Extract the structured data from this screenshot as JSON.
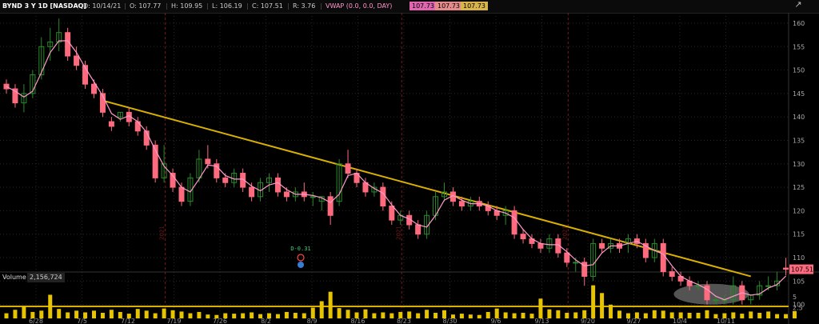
{
  "header": {
    "symbol": "BYND 3 Y 1D [NASDAQ]",
    "date": "D: 10/14/21",
    "open": "O: 107.77",
    "high": "H: 109.95",
    "low": "L: 106.19",
    "close": "C: 107.51",
    "range": "R: 3.76",
    "vwap_label": "VWAP (0.0, 0.0, DAY)",
    "vwap_val1": "107.73",
    "vwap_val2": "107.73",
    "vwap_val3": "107.73"
  },
  "volume_header": {
    "label": "Volume",
    "value": "2,156,724"
  },
  "icons": {
    "zoom": "magnify-zoom-icon"
  },
  "colors": {
    "up": "#2a8a2a",
    "down": "#ff6b7e",
    "vwap": "#ff99cc",
    "trend": "#d9b000",
    "volume": "#e6c400",
    "background": "#000000",
    "grid": "#262626"
  },
  "chart_data": {
    "type": "candlestick",
    "price_axis": {
      "ticks": [
        160,
        155,
        150,
        145,
        140,
        135,
        130,
        125,
        120,
        115,
        110,
        105,
        100
      ],
      "ylim": [
        97,
        163
      ]
    },
    "volume_axis": {
      "ticks": [
        5,
        2.5
      ]
    },
    "last_price_label": "107.51",
    "x_labels": [
      "6/28",
      "7/5",
      "7/12",
      "7/19",
      "7/26",
      "8/2",
      "8/9",
      "8/16",
      "8/23",
      "8/30",
      "9/6",
      "9/13",
      "9/20",
      "9/27",
      "10/4",
      "10/11"
    ],
    "annotation": "D-0.31",
    "candles": [
      {
        "o": 147,
        "h": 148,
        "l": 145,
        "c": 146
      },
      {
        "o": 146,
        "h": 147,
        "l": 142,
        "c": 143
      },
      {
        "o": 143,
        "h": 147,
        "l": 141,
        "c": 145
      },
      {
        "o": 145,
        "h": 150,
        "l": 144,
        "c": 149
      },
      {
        "o": 149,
        "h": 157,
        "l": 148,
        "c": 155
      },
      {
        "o": 155,
        "h": 159,
        "l": 152,
        "c": 156
      },
      {
        "o": 156,
        "h": 161,
        "l": 154,
        "c": 158
      },
      {
        "o": 158,
        "h": 159,
        "l": 152,
        "c": 153
      },
      {
        "o": 153,
        "h": 155,
        "l": 150,
        "c": 151
      },
      {
        "o": 151,
        "h": 152,
        "l": 146,
        "c": 147
      },
      {
        "o": 147,
        "h": 148,
        "l": 144,
        "c": 145
      },
      {
        "o": 145,
        "h": 146,
        "l": 140,
        "c": 141
      },
      {
        "o": 139,
        "h": 140,
        "l": 137,
        "c": 138
      },
      {
        "o": 140,
        "h": 141,
        "l": 139,
        "c": 141
      },
      {
        "o": 141,
        "h": 142,
        "l": 138,
        "c": 139
      },
      {
        "o": 139,
        "h": 140,
        "l": 136,
        "c": 137
      },
      {
        "o": 137,
        "h": 138,
        "l": 133,
        "c": 134
      },
      {
        "o": 134,
        "h": 135,
        "l": 126,
        "c": 127
      },
      {
        "o": 127,
        "h": 134,
        "l": 126,
        "c": 130
      },
      {
        "o": 128,
        "h": 129,
        "l": 124,
        "c": 125
      },
      {
        "o": 125,
        "h": 126,
        "l": 121,
        "c": 122
      },
      {
        "o": 122,
        "h": 128,
        "l": 121,
        "c": 127
      },
      {
        "o": 127,
        "h": 133,
        "l": 126,
        "c": 131
      },
      {
        "o": 131,
        "h": 134,
        "l": 129,
        "c": 130
      },
      {
        "o": 130,
        "h": 131,
        "l": 126,
        "c": 127
      },
      {
        "o": 127,
        "h": 128,
        "l": 125,
        "c": 126
      },
      {
        "o": 126,
        "h": 129,
        "l": 125,
        "c": 128
      },
      {
        "o": 128,
        "h": 129,
        "l": 124,
        "c": 125
      },
      {
        "o": 125,
        "h": 126,
        "l": 122,
        "c": 123
      },
      {
        "o": 123,
        "h": 127,
        "l": 122,
        "c": 126
      },
      {
        "o": 126,
        "h": 128,
        "l": 124,
        "c": 127
      },
      {
        "o": 127,
        "h": 128,
        "l": 123,
        "c": 124
      },
      {
        "o": 124,
        "h": 125,
        "l": 122,
        "c": 123
      },
      {
        "o": 123,
        "h": 125,
        "l": 122,
        "c": 124
      },
      {
        "o": 124,
        "h": 126,
        "l": 122,
        "c": 123
      },
      {
        "o": 123,
        "h": 124,
        "l": 121,
        "c": 123
      },
      {
        "o": 122,
        "h": 123,
        "l": 120,
        "c": 123
      },
      {
        "o": 123,
        "h": 124,
        "l": 117,
        "c": 119
      },
      {
        "o": 122,
        "h": 131,
        "l": 121,
        "c": 130
      },
      {
        "o": 130,
        "h": 133,
        "l": 127,
        "c": 128
      },
      {
        "o": 128,
        "h": 129,
        "l": 125,
        "c": 126
      },
      {
        "o": 126,
        "h": 127,
        "l": 123,
        "c": 124
      },
      {
        "o": 124,
        "h": 126,
        "l": 123,
        "c": 125
      },
      {
        "o": 125,
        "h": 126,
        "l": 120,
        "c": 121
      },
      {
        "o": 121,
        "h": 122,
        "l": 117,
        "c": 118
      },
      {
        "o": 118,
        "h": 120,
        "l": 117,
        "c": 119
      },
      {
        "o": 119,
        "h": 120,
        "l": 116,
        "c": 117
      },
      {
        "o": 117,
        "h": 118,
        "l": 114,
        "c": 115
      },
      {
        "o": 115,
        "h": 120,
        "l": 114,
        "c": 119
      },
      {
        "o": 119,
        "h": 124,
        "l": 118,
        "c": 123
      },
      {
        "o": 123,
        "h": 126,
        "l": 122,
        "c": 124
      },
      {
        "o": 124,
        "h": 125,
        "l": 121,
        "c": 122
      },
      {
        "o": 122,
        "h": 123,
        "l": 120,
        "c": 121
      },
      {
        "o": 121,
        "h": 123,
        "l": 120,
        "c": 122
      },
      {
        "o": 122,
        "h": 123,
        "l": 120,
        "c": 121
      },
      {
        "o": 121,
        "h": 122,
        "l": 119,
        "c": 120
      },
      {
        "o": 120,
        "h": 121,
        "l": 118,
        "c": 119
      },
      {
        "o": 119,
        "h": 121,
        "l": 117,
        "c": 120
      },
      {
        "o": 120,
        "h": 121,
        "l": 114,
        "c": 115
      },
      {
        "o": 115,
        "h": 116,
        "l": 113,
        "c": 114
      },
      {
        "o": 114,
        "h": 115,
        "l": 112,
        "c": 113
      },
      {
        "o": 113,
        "h": 114,
        "l": 111,
        "c": 112
      },
      {
        "o": 112,
        "h": 115,
        "l": 111,
        "c": 114
      },
      {
        "o": 114,
        "h": 115,
        "l": 110,
        "c": 111
      },
      {
        "o": 111,
        "h": 112,
        "l": 108,
        "c": 109
      },
      {
        "o": 109,
        "h": 110,
        "l": 107,
        "c": 109
      },
      {
        "o": 109,
        "h": 110,
        "l": 104,
        "c": 106
      },
      {
        "o": 106,
        "h": 114,
        "l": 105,
        "c": 113
      },
      {
        "o": 113,
        "h": 114,
        "l": 111,
        "c": 112
      },
      {
        "o": 112,
        "h": 114,
        "l": 111,
        "c": 113
      },
      {
        "o": 113,
        "h": 114,
        "l": 111,
        "c": 112
      },
      {
        "o": 113,
        "h": 115,
        "l": 111,
        "c": 114
      },
      {
        "o": 114,
        "h": 115,
        "l": 112,
        "c": 113
      },
      {
        "o": 113,
        "h": 114,
        "l": 109,
        "c": 110
      },
      {
        "o": 110,
        "h": 114,
        "l": 109,
        "c": 113
      },
      {
        "o": 113,
        "h": 114,
        "l": 106,
        "c": 107
      },
      {
        "o": 107,
        "h": 108,
        "l": 105,
        "c": 106
      },
      {
        "o": 106,
        "h": 107,
        "l": 104,
        "c": 105
      },
      {
        "o": 105,
        "h": 106,
        "l": 103,
        "c": 104
      },
      {
        "o": 104,
        "h": 105,
        "l": 103,
        "c": 104
      },
      {
        "o": 104,
        "h": 105,
        "l": 100,
        "c": 101
      },
      {
        "o": 101,
        "h": 102,
        "l": 100,
        "c": 101
      },
      {
        "o": 101,
        "h": 102,
        "l": 100,
        "c": 101
      },
      {
        "o": 101,
        "h": 106,
        "l": 100,
        "c": 104
      },
      {
        "o": 104,
        "h": 105,
        "l": 100,
        "c": 101
      },
      {
        "o": 101,
        "h": 102,
        "l": 100,
        "c": 102
      },
      {
        "o": 102,
        "h": 105,
        "l": 101,
        "c": 104
      },
      {
        "o": 104,
        "h": 106,
        "l": 103,
        "c": 104
      },
      {
        "o": 104,
        "h": 107,
        "l": 103,
        "c": 105
      },
      {
        "o": 107.77,
        "h": 109.95,
        "l": 106.19,
        "c": 107.51
      }
    ],
    "volumes": [
      1.2,
      2.0,
      2.8,
      1.5,
      1.8,
      5.5,
      2.2,
      1.4,
      1.8,
      1.4,
      1.8,
      1.3,
      2.0,
      1.5,
      1.1,
      2.2,
      1.8,
      1.2,
      2.3,
      1.9,
      1.6,
      1.2,
      1.5,
      0.9,
      0.8,
      1.2,
      1.1,
      1.2,
      1.4,
      1.0,
      1.2,
      1.0,
      1.5,
      1.3,
      1.2,
      2.5,
      4.0,
      6.2,
      2.4,
      2.0,
      1.4,
      2.1,
      1.2,
      1.4,
      1.2,
      1.5,
      1.6,
      1.2,
      2.0,
      1.3,
      1.9,
      0.9,
      1.1,
      0.9,
      0.8,
      1.5,
      2.3,
      1.4,
      1.2,
      1.3,
      1.1,
      4.6,
      2.1,
      1.9,
      1.3,
      1.4,
      1.9,
      7.7,
      5.9,
      3.2,
      1.8,
      1.2,
      1.4,
      1.2,
      1.9,
      1.8,
      1.4,
      1.4,
      1.3,
      1.3,
      1.9,
      1.0,
      1.2,
      1.4,
      1.1,
      1.6,
      1.3,
      1.6,
      1.0,
      1.0,
      1.7
    ],
    "date_separators": [
      {
        "index": 18,
        "label": "2021"
      },
      {
        "index": 45,
        "label": "2021"
      },
      {
        "index": 64,
        "label": "2021"
      }
    ],
    "trendline": {
      "from": {
        "index": 11,
        "price": 143.5
      },
      "to": {
        "index": 85,
        "price": 106
      }
    },
    "support_line": {
      "price": 99.6
    }
  }
}
